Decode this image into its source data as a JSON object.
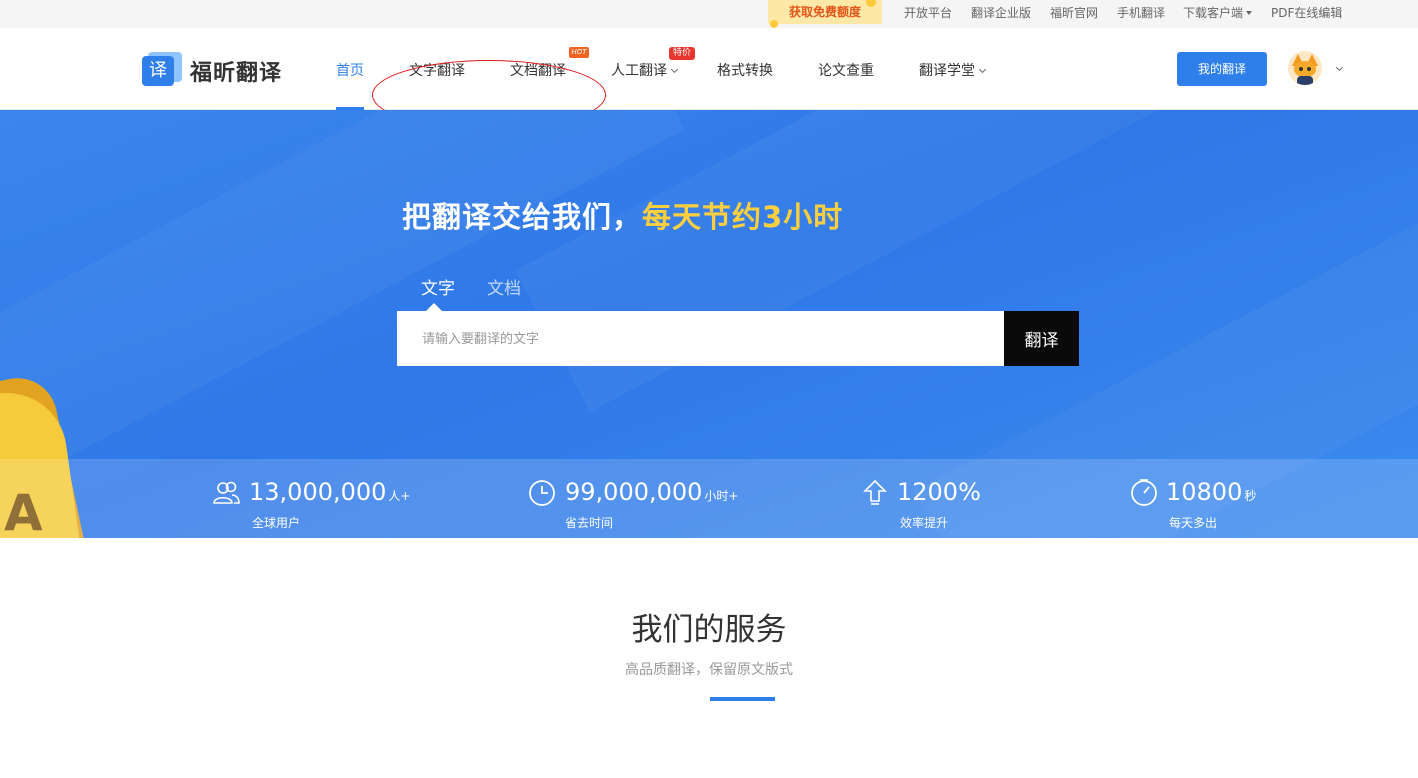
{
  "topbar": {
    "promo": "获取免费额度",
    "links": [
      {
        "label": "开放平台"
      },
      {
        "label": "翻译企业版"
      },
      {
        "label": "福昕官网"
      },
      {
        "label": "手机翻译"
      },
      {
        "label": "下载客户端"
      },
      {
        "label": "PDF在线编辑"
      }
    ]
  },
  "header": {
    "logo_glyph": "译",
    "logo_text": "福昕翻译",
    "nav": [
      {
        "label": "首页",
        "active": true
      },
      {
        "label": "文字翻译"
      },
      {
        "label": "文档翻译",
        "badge": "HOT"
      },
      {
        "label": "人工翻译",
        "badge": "特价",
        "dropdown": true
      },
      {
        "label": "格式转换"
      },
      {
        "label": "论文查重"
      },
      {
        "label": "翻译学堂",
        "dropdown": true
      }
    ],
    "my_translation": "我的翻译"
  },
  "hero": {
    "title_main": "把翻译交给我们，",
    "title_highlight": "每天节约3小时",
    "tabs": [
      {
        "label": "文字",
        "active": true
      },
      {
        "label": "文档"
      }
    ],
    "input_placeholder": "请输入要翻译的文字",
    "translate_button": "翻译",
    "deco_letter": "A"
  },
  "stats": [
    {
      "value": "13,000,000",
      "unit": "人+",
      "label": "全球用户",
      "icon": "users-icon"
    },
    {
      "value": "99,000,000",
      "unit": "小时+",
      "label": "省去时间",
      "icon": "clock-icon"
    },
    {
      "value": "1200%",
      "unit": "",
      "label": "效率提升",
      "icon": "arrow-up-icon"
    },
    {
      "value": "10800",
      "unit": "秒",
      "label": "每天多出",
      "icon": "stopwatch-icon"
    }
  ],
  "services": {
    "title": "我们的服务",
    "subtitle": "高品质翻译，保留原文版式"
  },
  "colors": {
    "brand": "#2f7fea",
    "highlight": "#ffcf3d",
    "annotation": "#d9191a"
  }
}
